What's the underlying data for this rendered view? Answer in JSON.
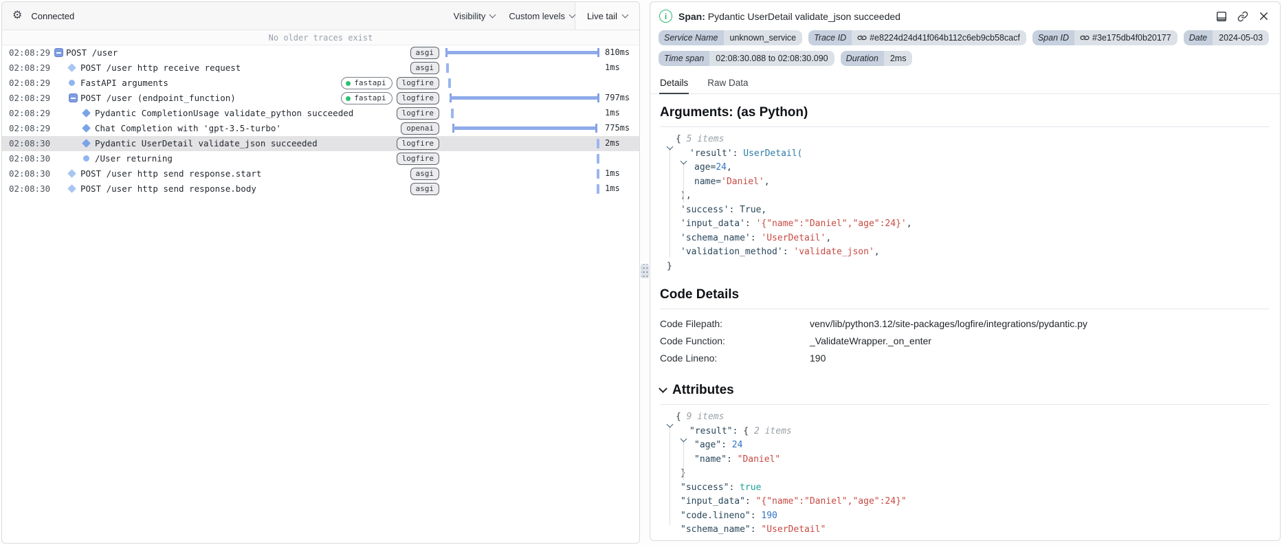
{
  "colors": {
    "bar_blue": "#8fabe9",
    "scope_green": "#2fbf71",
    "info_green": "#2bb673",
    "string_red": "#c74a42",
    "number_blue": "#3273c5",
    "bool_teal": "#16a096",
    "selected_row": "#e3e3e5",
    "meta_label_bg": "#c6d0de",
    "meta_value_bg": "#dce1e8"
  },
  "left_panel": {
    "toolbar": {
      "status": "Connected",
      "visibility_label": "Visibility",
      "custom_levels_label": "Custom levels",
      "live_tail_label": "Live tail"
    },
    "notice": "No older traces exist",
    "rows": [
      {
        "time": "02:08:29",
        "icon": "collapse",
        "level": 0,
        "name": "POST /user",
        "selected": false,
        "badges": [
          {
            "label": "asgi",
            "style": "gray"
          }
        ],
        "bar": {
          "kind": "span",
          "start": 0,
          "end": 100
        },
        "duration": "810ms"
      },
      {
        "time": "02:08:29",
        "icon": "diamond-light",
        "level": 1,
        "name": "POST /user http receive request",
        "selected": false,
        "badges": [
          {
            "label": "asgi",
            "style": "gray"
          }
        ],
        "bar": {
          "kind": "tick",
          "pos": 0.5
        },
        "duration": "1ms"
      },
      {
        "time": "02:08:29",
        "icon": "circle",
        "level": 1,
        "name": "FastAPI arguments",
        "selected": false,
        "badges": [
          {
            "label": "fastapi",
            "style": "scope"
          },
          {
            "label": "logfire",
            "style": "gray"
          }
        ],
        "bar": {
          "kind": "tick",
          "pos": 2
        },
        "duration": ""
      },
      {
        "time": "02:08:29",
        "icon": "collapse",
        "level": 1,
        "name": "POST /user (endpoint_function)",
        "selected": false,
        "badges": [
          {
            "label": "fastapi",
            "style": "scope"
          },
          {
            "label": "logfire",
            "style": "gray"
          }
        ],
        "bar": {
          "kind": "span",
          "start": 2.5,
          "end": 100
        },
        "duration": "797ms"
      },
      {
        "time": "02:08:29",
        "icon": "diamond",
        "level": 2,
        "name": "Pydantic CompletionUsage validate_python succeeded",
        "selected": false,
        "badges": [
          {
            "label": "logfire",
            "style": "gray"
          }
        ],
        "bar": {
          "kind": "tick",
          "pos": 3.5
        },
        "duration": "1ms"
      },
      {
        "time": "02:08:29",
        "icon": "diamond",
        "level": 2,
        "name": "Chat Completion with 'gpt-3.5-turbo'",
        "selected": false,
        "badges": [
          {
            "label": "openai",
            "style": "gray"
          }
        ],
        "bar": {
          "kind": "span",
          "start": 4.5,
          "end": 98.5
        },
        "duration": "775ms"
      },
      {
        "time": "02:08:30",
        "icon": "diamond",
        "level": 2,
        "name": "Pydantic UserDetail validate_json succeeded",
        "selected": true,
        "badges": [
          {
            "label": "logfire",
            "style": "gray"
          }
        ],
        "bar": {
          "kind": "tick",
          "pos": 98
        },
        "duration": "2ms"
      },
      {
        "time": "02:08:30",
        "icon": "circle",
        "level": 2,
        "name": "/User returning",
        "selected": false,
        "badges": [
          {
            "label": "logfire",
            "style": "gray"
          }
        ],
        "bar": {
          "kind": "tick",
          "pos": 100
        },
        "duration": ""
      },
      {
        "time": "02:08:30",
        "icon": "diamond-light",
        "level": 1,
        "name": "POST /user http send response.start",
        "selected": false,
        "badges": [
          {
            "label": "asgi",
            "style": "gray"
          }
        ],
        "bar": {
          "kind": "tick",
          "pos": 99.5
        },
        "duration": "1ms"
      },
      {
        "time": "02:08:30",
        "icon": "diamond-light",
        "level": 1,
        "name": "POST /user http send response.body",
        "selected": false,
        "badges": [
          {
            "label": "asgi",
            "style": "gray"
          }
        ],
        "bar": {
          "kind": "tick",
          "pos": 99.5
        },
        "duration": "1ms"
      }
    ]
  },
  "right_panel": {
    "header": {
      "kind_label": "Span:",
      "title": "Pydantic UserDetail validate_json succeeded"
    },
    "meta": [
      {
        "label": "Service Name",
        "value": "unknown_service",
        "link": false
      },
      {
        "label": "Trace ID",
        "value": "#e8224d24d41f064b112c6eb9cb58cacf",
        "link": true
      },
      {
        "label": "Span ID",
        "value": "#3e175db4f0b20177",
        "link": true
      },
      {
        "label": "Date",
        "value": "2024-05-03",
        "link": false
      },
      {
        "label": "Time span",
        "value": "02:08:30.088 to 02:08:30.090",
        "link": false
      },
      {
        "label": "Duration",
        "value": "2ms",
        "link": false
      }
    ],
    "tabs": [
      {
        "label": "Details",
        "active": true
      },
      {
        "label": "Raw Data",
        "active": false
      }
    ],
    "arguments_heading": "Arguments: (as Python)",
    "python_view": [
      {
        "lvl": 0,
        "tk": [
          {
            "t": "chev"
          },
          {
            "t": "p",
            "v": "{ "
          },
          {
            "t": "items",
            "v": "5 items"
          }
        ]
      },
      {
        "lvl": 1,
        "tk": [
          {
            "t": "chev"
          },
          {
            "t": "key",
            "v": "'result'"
          },
          {
            "t": "p",
            "v": ": "
          },
          {
            "t": "call",
            "v": "UserDetail("
          }
        ]
      },
      {
        "lvl": 2,
        "tk": [
          {
            "t": "plain",
            "v": "age="
          },
          {
            "t": "num",
            "v": "24"
          },
          {
            "t": "p",
            "v": ","
          }
        ]
      },
      {
        "lvl": 2,
        "tk": [
          {
            "t": "plain",
            "v": "name="
          },
          {
            "t": "str",
            "v": "'Daniel'"
          },
          {
            "t": "p",
            "v": ","
          }
        ]
      },
      {
        "lvl": 1,
        "tk": [
          {
            "t": "p",
            "v": "),"
          }
        ]
      },
      {
        "lvl": 1,
        "tk": [
          {
            "t": "key",
            "v": "'success'"
          },
          {
            "t": "p",
            "v": ": "
          },
          {
            "t": "plain",
            "v": "True,"
          }
        ]
      },
      {
        "lvl": 1,
        "tk": [
          {
            "t": "key",
            "v": "'input_data'"
          },
          {
            "t": "p",
            "v": ": "
          },
          {
            "t": "str",
            "v": "'{\"name\":\"Daniel\",\"age\":24}'"
          },
          {
            "t": "p",
            "v": ","
          }
        ]
      },
      {
        "lvl": 1,
        "tk": [
          {
            "t": "key",
            "v": "'schema_name'"
          },
          {
            "t": "p",
            "v": ": "
          },
          {
            "t": "str",
            "v": "'UserDetail'"
          },
          {
            "t": "p",
            "v": ","
          }
        ]
      },
      {
        "lvl": 1,
        "tk": [
          {
            "t": "key",
            "v": "'validation_method'"
          },
          {
            "t": "p",
            "v": ": "
          },
          {
            "t": "str",
            "v": "'validate_json'"
          },
          {
            "t": "p",
            "v": ","
          }
        ]
      },
      {
        "lvl": 0,
        "tk": [
          {
            "t": "p",
            "v": "}"
          }
        ]
      }
    ],
    "code_details": {
      "heading": "Code Details",
      "rows": [
        {
          "label": "Code Filepath:",
          "value": "venv/lib/python3.12/site-packages/logfire/integrations/pydantic.py"
        },
        {
          "label": "Code Function:",
          "value": "_ValidateWrapper._on_enter"
        },
        {
          "label": "Code Lineno:",
          "value": "190"
        }
      ]
    },
    "attributes_heading": "Attributes",
    "attributes_view": [
      {
        "lvl": 0,
        "tk": [
          {
            "t": "chev"
          },
          {
            "t": "p",
            "v": "{ "
          },
          {
            "t": "items",
            "v": "9 items"
          }
        ]
      },
      {
        "lvl": 1,
        "tk": [
          {
            "t": "chev"
          },
          {
            "t": "key",
            "v": "\"result\""
          },
          {
            "t": "p",
            "v": ": { "
          },
          {
            "t": "items",
            "v": "2 items"
          }
        ]
      },
      {
        "lvl": 2,
        "tk": [
          {
            "t": "key",
            "v": "\"age\""
          },
          {
            "t": "p",
            "v": ": "
          },
          {
            "t": "num",
            "v": "24"
          }
        ]
      },
      {
        "lvl": 2,
        "tk": [
          {
            "t": "key",
            "v": "\"name\""
          },
          {
            "t": "p",
            "v": ": "
          },
          {
            "t": "str",
            "v": "\"Daniel\""
          }
        ]
      },
      {
        "lvl": 1,
        "tk": [
          {
            "t": "p",
            "v": "}"
          }
        ]
      },
      {
        "lvl": 1,
        "tk": [
          {
            "t": "key",
            "v": "\"success\""
          },
          {
            "t": "p",
            "v": ": "
          },
          {
            "t": "bool",
            "v": "true"
          }
        ]
      },
      {
        "lvl": 1,
        "tk": [
          {
            "t": "key",
            "v": "\"input_data\""
          },
          {
            "t": "p",
            "v": ": "
          },
          {
            "t": "str",
            "v": "\"{\"name\":\"Daniel\",\"age\":24}\""
          }
        ]
      },
      {
        "lvl": 1,
        "tk": [
          {
            "t": "key",
            "v": "\"code.lineno\""
          },
          {
            "t": "p",
            "v": ": "
          },
          {
            "t": "num",
            "v": "190"
          }
        ]
      },
      {
        "lvl": 1,
        "tk": [
          {
            "t": "key",
            "v": "\"schema_name\""
          },
          {
            "t": "p",
            "v": ": "
          },
          {
            "t": "str",
            "v": "\"UserDetail\""
          }
        ]
      }
    ]
  }
}
